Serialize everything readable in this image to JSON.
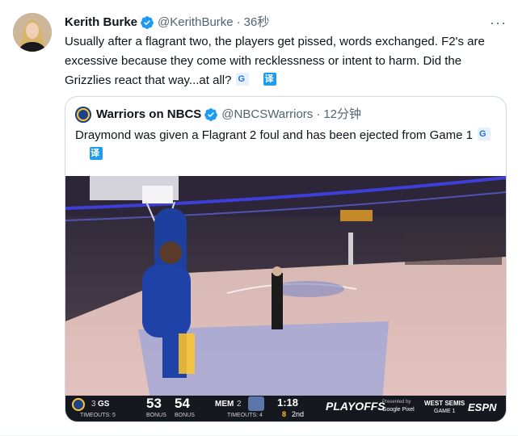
{
  "tweet": {
    "author_name": "Kerith Burke",
    "handle": "@KerithBurke",
    "time": "36秒",
    "text": "Usually after a flagrant two, the players get pissed, words exchanged. F2's are excessive because they come with recklessness or intent to harm. Did the Grizzlies react that way...at all?",
    "more_icon": "more-icon"
  },
  "quote": {
    "author_name": "Warriors on NBCS",
    "handle": "@NBCSWarriors",
    "time": "12分钟",
    "text": "Draymond was given a Flagrant 2 foul and has been ejected from Game 1"
  },
  "translate": {
    "google_glyph": "G",
    "translate_glyph": "译"
  },
  "scoreboard": {
    "team1": "GS",
    "team1_seed": "3",
    "team1_score": "53",
    "team1_timeouts": "TIMEOUTS: 5",
    "team2": "MEM",
    "team2_seed": "2",
    "team2_score": "54",
    "team2_timeouts": "TIMEOUTS: 4",
    "bonus1": "BONUS",
    "bonus2": "BONUS",
    "clock": "1:18",
    "shot_clock": "8",
    "period": "2nd",
    "playoffs": "PLAYOFFS",
    "presented_by": "Presented by",
    "sponsor": "Google Pixel",
    "series": "WEST SEMIS",
    "game": "GAME 1",
    "network": "ESPN"
  },
  "colors": {
    "link": "#1d9bf0",
    "muted": "#536471",
    "warriors_blue": "#1d428a",
    "warriors_gold": "#ffc72c"
  }
}
